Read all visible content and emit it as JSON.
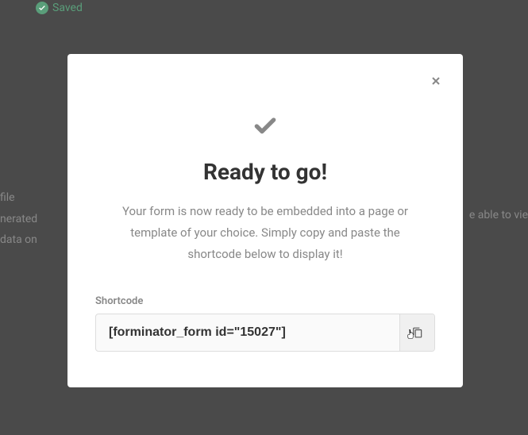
{
  "background": {
    "save_label": "Saved",
    "left_text_1": "file",
    "left_text_2": "nerated",
    "left_text_3": "data on",
    "right_text": "e able to vie"
  },
  "modal": {
    "title": "Ready to go!",
    "description": "Your form is now ready to be embedded into a page or template of your choice. Simply copy and paste the shortcode below to display it!",
    "shortcode_label": "Shortcode",
    "shortcode_value": "[forminator_form id=\"15027\"]"
  }
}
